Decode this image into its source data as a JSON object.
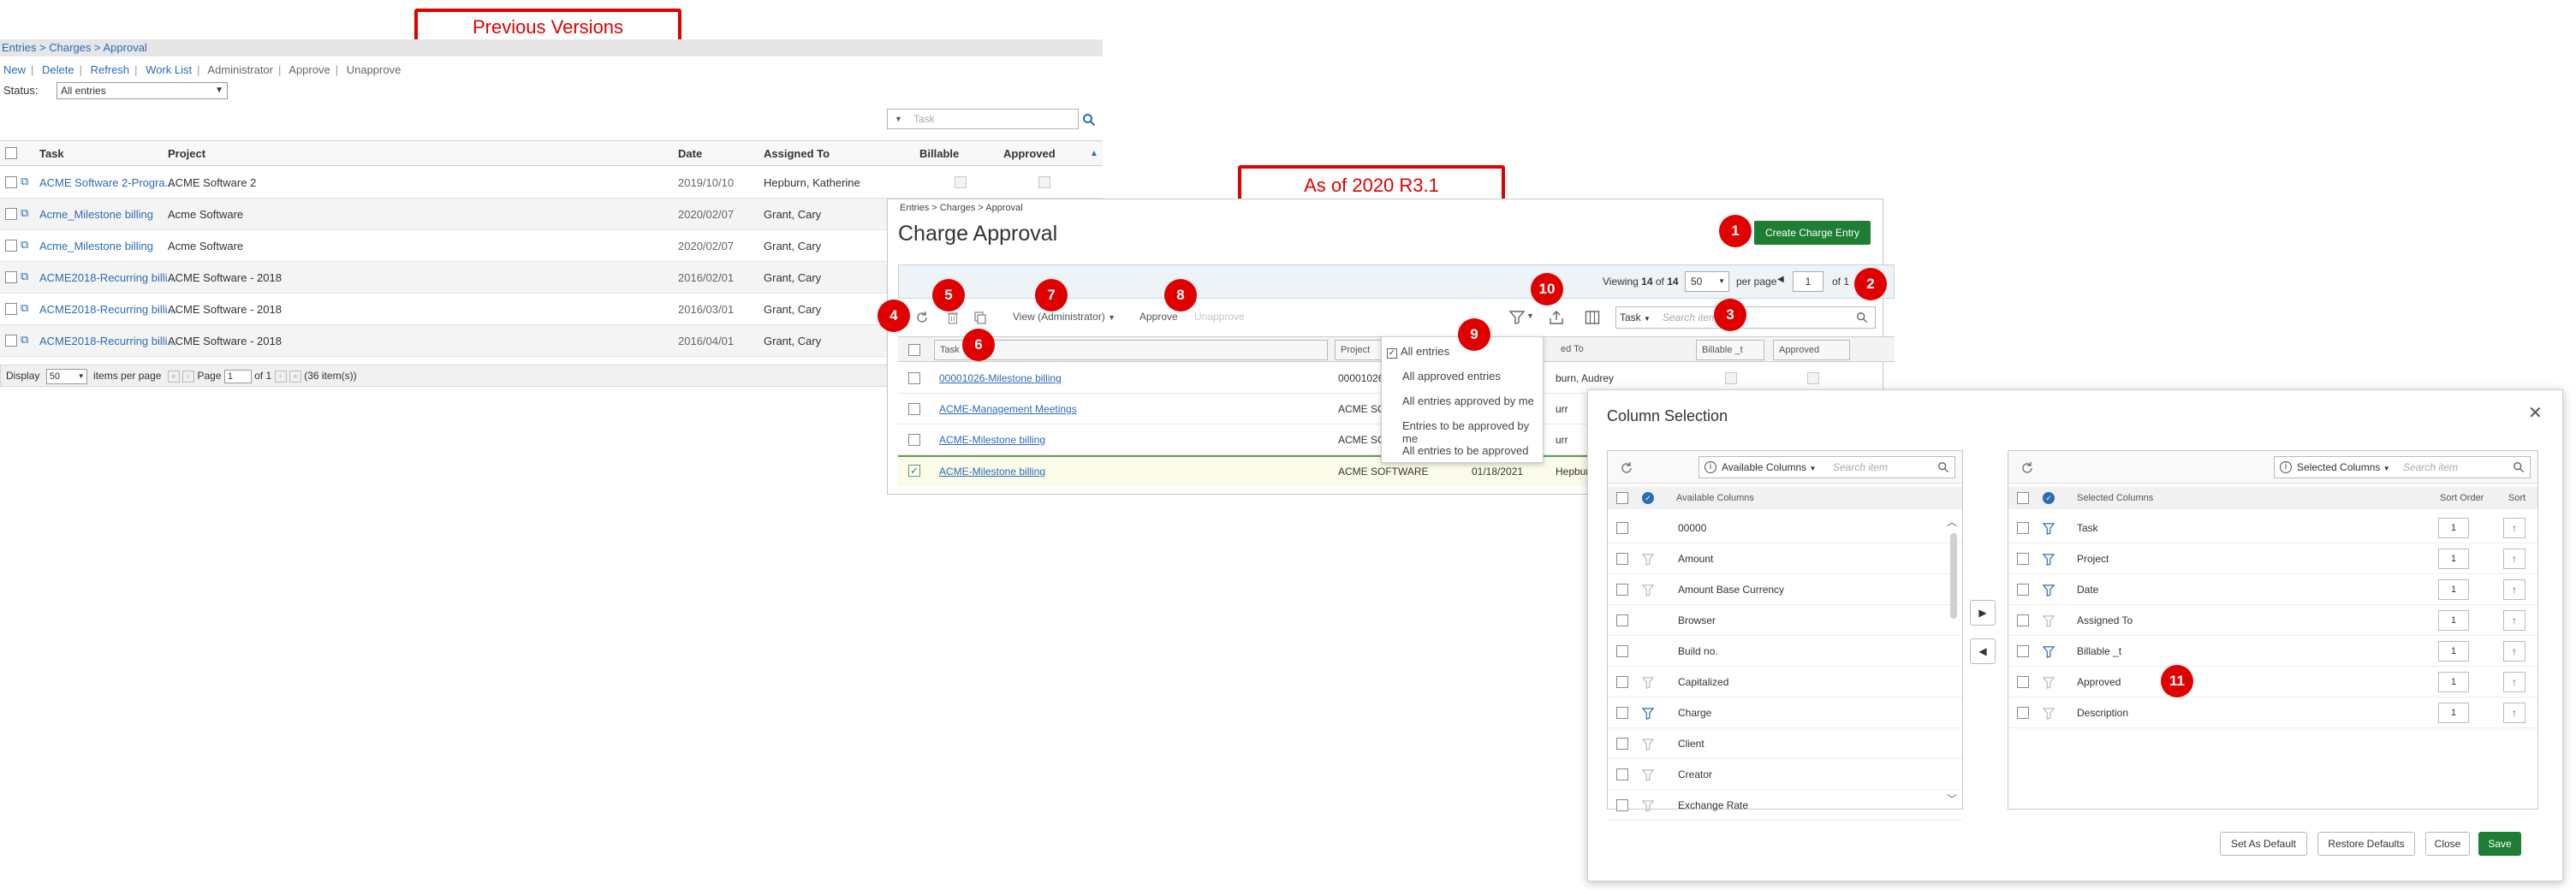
{
  "annotations": {
    "previous_versions": "Previous Versions",
    "new_version": "As of 2020 R3.1",
    "badges": [
      "1",
      "2",
      "3",
      "4",
      "5",
      "6",
      "7",
      "8",
      "9",
      "10",
      "11"
    ]
  },
  "old_ui": {
    "breadcrumb": "Entries > Charges > Approval",
    "menu": [
      "New",
      "Delete",
      "Refresh",
      "Work List",
      "Administrator",
      "Approve",
      "Unapprove"
    ],
    "status_label": "Status:",
    "status_value": "All entries",
    "task_placeholder": "Task",
    "columns": [
      "Task",
      "Project",
      "Date",
      "Assigned To",
      "Billable",
      "Approved"
    ],
    "rows": [
      {
        "task": "ACME Software 2-Progra...",
        "project": "ACME Software 2",
        "date": "2019/10/10",
        "assigned": "Hepburn, Katherine"
      },
      {
        "task": "Acme_Milestone billing",
        "project": "Acme Software",
        "date": "2020/02/07",
        "assigned": "Grant, Cary"
      },
      {
        "task": "Acme_Milestone billing",
        "project": "Acme Software",
        "date": "2020/02/07",
        "assigned": "Grant, Cary"
      },
      {
        "task": "ACME2018-Recurring billi...",
        "project": "ACME Software - 2018",
        "date": "2016/02/01",
        "assigned": "Grant, Cary"
      },
      {
        "task": "ACME2018-Recurring billi...",
        "project": "ACME Software - 2018",
        "date": "2016/03/01",
        "assigned": "Grant, Cary"
      },
      {
        "task": "ACME2018-Recurring billi...",
        "project": "ACME Software - 2018",
        "date": "2016/04/01",
        "assigned": "Grant, Cary"
      }
    ],
    "pager": {
      "display_label": "Display",
      "display_value": "50",
      "items_per_page": "items per page",
      "page_label": "Page",
      "page_value": "1",
      "of_pages": "of 1",
      "total": "(36 item(s))"
    }
  },
  "new_ui": {
    "breadcrumb": "Entries > Charges > Approval",
    "title": "Charge Approval",
    "create_button": "Create Charge Entry",
    "viewing_prefix": "Viewing",
    "viewing_count": "14",
    "viewing_of": "of",
    "viewing_total": "14",
    "per_page_value": "50",
    "per_page_label": "per page",
    "page_value": "1",
    "page_of": "of 1",
    "view_menu": "View (Administrator)",
    "approve": "Approve",
    "unapprove": "Unapprove",
    "search_field": "Task",
    "search_placeholder": "Search item",
    "columns": [
      "Task",
      "Project",
      "ed To",
      "Billable _t",
      "Approved"
    ],
    "rows": [
      {
        "task": "00001026-Milestone billing",
        "project": "00001026",
        "assigned": "burn, Audrey"
      },
      {
        "task": "ACME-Management Meetings",
        "project": "ACME SOF",
        "assigned": "urr"
      },
      {
        "task": "ACME-Milestone billing",
        "project": "ACME SOF",
        "assigned": "urr"
      },
      {
        "task": "ACME-Milestone billing",
        "project": "ACME SOFTWARE",
        "date": "01/18/2021",
        "assigned": "Hepburn"
      }
    ],
    "filter_menu": [
      "All entries",
      "All approved entries",
      "All entries approved by me",
      "Entries to be approved by me",
      "All entries to be approved"
    ]
  },
  "dialog": {
    "title": "Column Selection",
    "available": {
      "dropdown": "Available Columns",
      "placeholder": "Search item",
      "header": "Available Columns",
      "items": [
        "00000",
        "Amount",
        "Amount Base Currency",
        "Browser",
        "Build no.",
        "Capitalized",
        "Charge",
        "Client",
        "Creator",
        "Exchange Rate"
      ]
    },
    "selected": {
      "dropdown": "Selected Columns",
      "placeholder": "Search item",
      "header": "Selected Columns",
      "sort_order_header": "Sort Order",
      "sort_header": "Sort",
      "items": [
        {
          "name": "Task",
          "order": "1"
        },
        {
          "name": "Project",
          "order": "1"
        },
        {
          "name": "Date",
          "order": "1"
        },
        {
          "name": "Assigned To",
          "order": "1"
        },
        {
          "name": "Billable _t",
          "order": "1"
        },
        {
          "name": "Approved",
          "order": "1"
        },
        {
          "name": "Description",
          "order": "1"
        }
      ]
    },
    "buttons": {
      "set_default": "Set As Default",
      "restore": "Restore Defaults",
      "close": "Close",
      "save": "Save"
    }
  },
  "colors": {
    "annotation_red": "#e00000",
    "link_blue": "#2a6db5",
    "primary_green": "#1e7e34",
    "filter_blue": "#2a6db5"
  }
}
